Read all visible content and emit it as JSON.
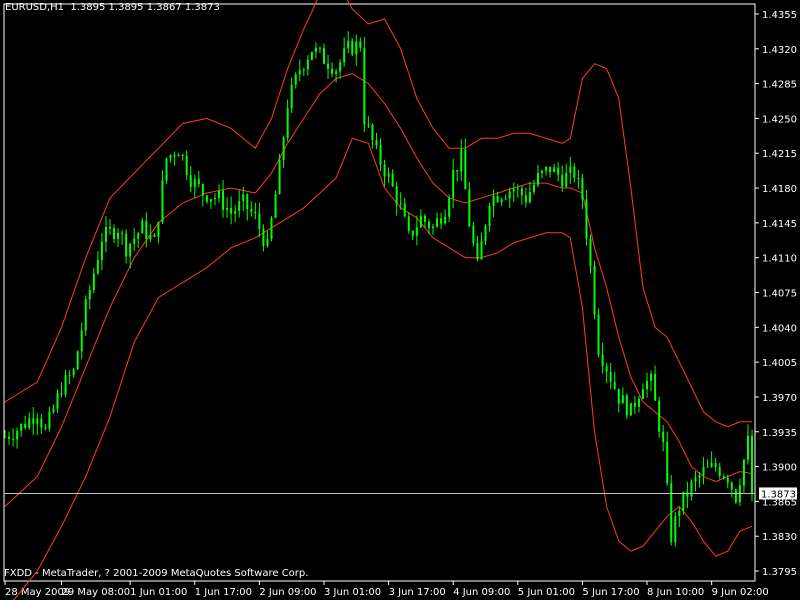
{
  "header": {
    "symbol_line": "EURUSD,H1  1.3895 1.3895 1.3867 1.3873"
  },
  "footer": {
    "copyright": "FXDD - MetaTrader, ? 2001-2009 MetaQuotes Software Corp."
  },
  "colors": {
    "background": "#000000",
    "axis": "#ffffff",
    "candles": "#00ff00",
    "bollinger": "#ff3d1a",
    "current_price_line": "#c0c0c0"
  },
  "chart_data": {
    "type": "candlestick",
    "symbol": "EURUSD",
    "timeframe": "H1",
    "ohlc_last": {
      "open": 1.3895,
      "high": 1.3895,
      "low": 1.3867,
      "close": 1.3873
    },
    "current_price": 1.3873,
    "current_price_label": "1.3873",
    "y_range": [
      1.3785,
      1.4365
    ],
    "y_ticks": [
      "1.4355",
      "1.4320",
      "1.4285",
      "1.4250",
      "1.4215",
      "1.4180",
      "1.4145",
      "1.4110",
      "1.4075",
      "1.4040",
      "1.4005",
      "1.3970",
      "1.3935",
      "1.3900",
      "1.3865",
      "1.3830",
      "1.3795"
    ],
    "x_ticks": [
      {
        "label": "28 May 2009",
        "bar": 0
      },
      {
        "label": "29 May 08:00",
        "bar": 14
      },
      {
        "label": "1 Jun 01:00",
        "bar": 31
      },
      {
        "label": "1 Jun 17:00",
        "bar": 47
      },
      {
        "label": "2 Jun 09:00",
        "bar": 63
      },
      {
        "label": "3 Jun 01:00",
        "bar": 79
      },
      {
        "label": "3 Jun 17:00",
        "bar": 95
      },
      {
        "label": "4 Jun 09:00",
        "bar": 111
      },
      {
        "label": "5 Jun 01:00",
        "bar": 127
      },
      {
        "label": "5 Jun 17:00",
        "bar": 143
      },
      {
        "label": "8 Jun 10:00",
        "bar": 159
      },
      {
        "label": "9 Jun 02:00",
        "bar": 175
      }
    ],
    "bar_count": 186,
    "close_path": [
      [
        0,
        1.393
      ],
      [
        4,
        1.394
      ],
      [
        8,
        1.3955
      ],
      [
        10,
        1.3935
      ],
      [
        14,
        1.398
      ],
      [
        17,
        1.3995
      ],
      [
        20,
        1.406
      ],
      [
        24,
        1.413
      ],
      [
        28,
        1.414
      ],
      [
        30,
        1.412
      ],
      [
        34,
        1.414
      ],
      [
        37,
        1.4125
      ],
      [
        40,
        1.421
      ],
      [
        43,
        1.422
      ],
      [
        46,
        1.419
      ],
      [
        49,
        1.4175
      ],
      [
        53,
        1.417
      ],
      [
        56,
        1.4155
      ],
      [
        59,
        1.4165
      ],
      [
        62,
        1.415
      ],
      [
        65,
        1.412
      ],
      [
        68,
        1.42
      ],
      [
        70,
        1.4265
      ],
      [
        73,
        1.43
      ],
      [
        76,
        1.432
      ],
      [
        79,
        1.431
      ],
      [
        82,
        1.43
      ],
      [
        85,
        1.432
      ],
      [
        88,
        1.4325
      ],
      [
        89,
        1.425
      ],
      [
        92,
        1.4215
      ],
      [
        95,
        1.419
      ],
      [
        98,
        1.416
      ],
      [
        100,
        1.413
      ],
      [
        103,
        1.415
      ],
      [
        106,
        1.414
      ],
      [
        109,
        1.416
      ],
      [
        111,
        1.4195
      ],
      [
        113,
        1.421
      ],
      [
        115,
        1.4145
      ],
      [
        117,
        1.41
      ],
      [
        120,
        1.417
      ],
      [
        123,
        1.4175
      ],
      [
        126,
        1.418
      ],
      [
        129,
        1.417
      ],
      [
        132,
        1.419
      ],
      [
        135,
        1.42
      ],
      [
        138,
        1.419
      ],
      [
        141,
        1.4195
      ],
      [
        143,
        1.417
      ],
      [
        145,
        1.41
      ],
      [
        147,
        1.402
      ],
      [
        149,
        1.4
      ],
      [
        152,
        1.397
      ],
      [
        155,
        1.3955
      ],
      [
        158,
        1.3985
      ],
      [
        160,
        1.3985
      ],
      [
        163,
        1.392
      ],
      [
        165,
        1.383
      ],
      [
        167,
        1.386
      ],
      [
        170,
        1.388
      ],
      [
        173,
        1.3895
      ],
      [
        176,
        1.39
      ],
      [
        179,
        1.389
      ],
      [
        181,
        1.387
      ],
      [
        184,
        1.3925
      ],
      [
        185,
        1.3873
      ]
    ],
    "bollinger_upper": [
      [
        0,
        1.3965
      ],
      [
        8,
        1.3985
      ],
      [
        14,
        1.404
      ],
      [
        20,
        1.411
      ],
      [
        26,
        1.417
      ],
      [
        32,
        1.4195
      ],
      [
        38,
        1.422
      ],
      [
        44,
        1.4245
      ],
      [
        50,
        1.425
      ],
      [
        56,
        1.424
      ],
      [
        62,
        1.422
      ],
      [
        66,
        1.425
      ],
      [
        70,
        1.43
      ],
      [
        74,
        1.434
      ],
      [
        78,
        1.4375
      ],
      [
        82,
        1.439
      ],
      [
        86,
        1.436
      ],
      [
        90,
        1.4345
      ],
      [
        94,
        1.435
      ],
      [
        98,
        1.432
      ],
      [
        102,
        1.427
      ],
      [
        106,
        1.424
      ],
      [
        110,
        1.422
      ],
      [
        114,
        1.422
      ],
      [
        118,
        1.423
      ],
      [
        122,
        1.423
      ],
      [
        126,
        1.4235
      ],
      [
        130,
        1.4235
      ],
      [
        134,
        1.423
      ],
      [
        138,
        1.4225
      ],
      [
        140,
        1.423
      ],
      [
        143,
        1.429
      ],
      [
        146,
        1.4305
      ],
      [
        149,
        1.43
      ],
      [
        152,
        1.427
      ],
      [
        155,
        1.418
      ],
      [
        158,
        1.408
      ],
      [
        161,
        1.404
      ],
      [
        164,
        1.403
      ],
      [
        167,
        1.4005
      ],
      [
        170,
        1.398
      ],
      [
        173,
        1.3955
      ],
      [
        176,
        1.3945
      ],
      [
        179,
        1.394
      ],
      [
        182,
        1.3945
      ],
      [
        185,
        1.3945
      ]
    ],
    "bollinger_middle": [
      [
        0,
        1.386
      ],
      [
        8,
        1.389
      ],
      [
        14,
        1.394
      ],
      [
        20,
        1.4
      ],
      [
        26,
        1.406
      ],
      [
        32,
        1.411
      ],
      [
        38,
        1.4145
      ],
      [
        44,
        1.4165
      ],
      [
        50,
        1.4175
      ],
      [
        56,
        1.418
      ],
      [
        62,
        1.4175
      ],
      [
        66,
        1.4195
      ],
      [
        70,
        1.4225
      ],
      [
        74,
        1.425
      ],
      [
        78,
        1.4275
      ],
      [
        82,
        1.429
      ],
      [
        86,
        1.4295
      ],
      [
        90,
        1.4285
      ],
      [
        94,
        1.4265
      ],
      [
        98,
        1.424
      ],
      [
        102,
        1.421
      ],
      [
        106,
        1.4185
      ],
      [
        110,
        1.417
      ],
      [
        114,
        1.4165
      ],
      [
        118,
        1.417
      ],
      [
        122,
        1.4175
      ],
      [
        126,
        1.418
      ],
      [
        130,
        1.4185
      ],
      [
        134,
        1.4185
      ],
      [
        138,
        1.418
      ],
      [
        140,
        1.418
      ],
      [
        143,
        1.4175
      ],
      [
        146,
        1.412
      ],
      [
        149,
        1.408
      ],
      [
        152,
        1.403
      ],
      [
        155,
        1.399
      ],
      [
        158,
        1.3965
      ],
      [
        161,
        1.3955
      ],
      [
        164,
        1.3945
      ],
      [
        167,
        1.3925
      ],
      [
        170,
        1.39
      ],
      [
        173,
        1.389
      ],
      [
        176,
        1.3885
      ],
      [
        179,
        1.389
      ],
      [
        182,
        1.3895
      ],
      [
        185,
        1.3893
      ]
    ],
    "bollinger_lower": [
      [
        0,
        1.3755
      ],
      [
        8,
        1.3795
      ],
      [
        14,
        1.384
      ],
      [
        20,
        1.389
      ],
      [
        26,
        1.395
      ],
      [
        32,
        1.4025
      ],
      [
        38,
        1.407
      ],
      [
        44,
        1.4085
      ],
      [
        50,
        1.41
      ],
      [
        56,
        1.412
      ],
      [
        62,
        1.413
      ],
      [
        66,
        1.414
      ],
      [
        70,
        1.415
      ],
      [
        74,
        1.416
      ],
      [
        78,
        1.4175
      ],
      [
        82,
        1.419
      ],
      [
        86,
        1.423
      ],
      [
        90,
        1.4225
      ],
      [
        94,
        1.418
      ],
      [
        98,
        1.416
      ],
      [
        102,
        1.415
      ],
      [
        106,
        1.413
      ],
      [
        110,
        1.412
      ],
      [
        114,
        1.411
      ],
      [
        118,
        1.411
      ],
      [
        122,
        1.4115
      ],
      [
        126,
        1.4125
      ],
      [
        130,
        1.413
      ],
      [
        134,
        1.4135
      ],
      [
        138,
        1.4135
      ],
      [
        140,
        1.413
      ],
      [
        143,
        1.406
      ],
      [
        146,
        1.3935
      ],
      [
        149,
        1.386
      ],
      [
        152,
        1.3825
      ],
      [
        155,
        1.3815
      ],
      [
        158,
        1.382
      ],
      [
        161,
        1.3835
      ],
      [
        164,
        1.385
      ],
      [
        167,
        1.386
      ],
      [
        170,
        1.3845
      ],
      [
        173,
        1.3825
      ],
      [
        176,
        1.381
      ],
      [
        179,
        1.3815
      ],
      [
        182,
        1.3835
      ],
      [
        185,
        1.384
      ]
    ]
  }
}
